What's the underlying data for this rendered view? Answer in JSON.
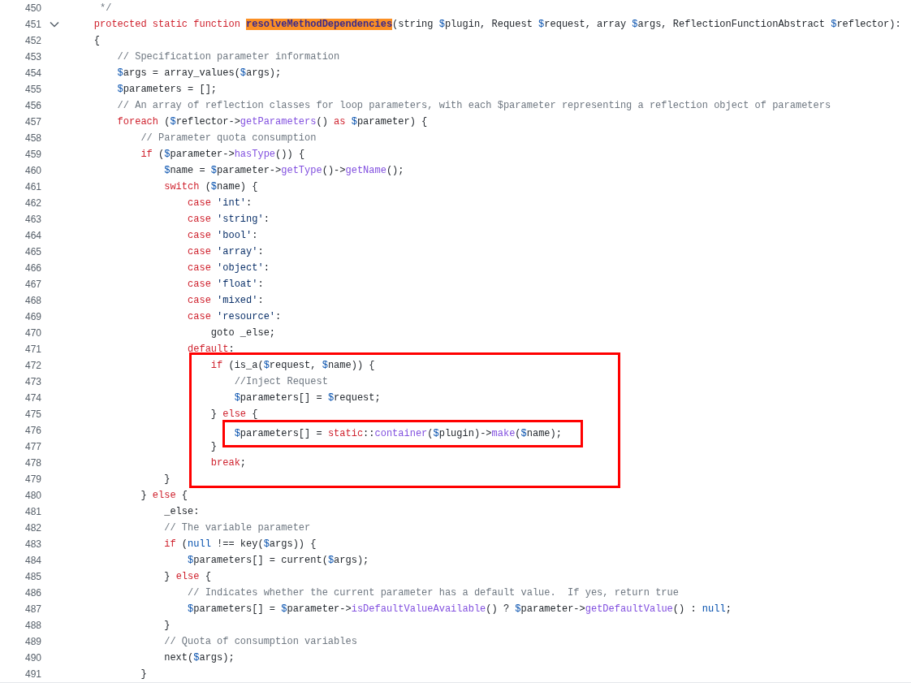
{
  "lines": [
    {
      "number": "450",
      "foldable": false,
      "tokens": [
        {
          "text": "     */",
          "kind": "comment"
        }
      ]
    },
    {
      "number": "451",
      "foldable": true,
      "tokens": [
        {
          "text": "    protected static function ",
          "kind": "keyword"
        },
        {
          "text": "resolveMethodDependencies",
          "kind": "match"
        },
        {
          "text": "(string ",
          "kind": "plain"
        },
        {
          "text": "$",
          "kind": "variable"
        },
        {
          "text": "plugin, Request ",
          "kind": "plain"
        },
        {
          "text": "$",
          "kind": "variable"
        },
        {
          "text": "request, array ",
          "kind": "plain"
        },
        {
          "text": "$",
          "kind": "variable"
        },
        {
          "text": "args, ReflectionFunctionAbstract ",
          "kind": "plain"
        },
        {
          "text": "$",
          "kind": "variable"
        },
        {
          "text": "reflector):",
          "kind": "plain"
        }
      ]
    },
    {
      "number": "452",
      "foldable": false,
      "tokens": [
        {
          "text": "    {",
          "kind": "plain"
        }
      ]
    },
    {
      "number": "453",
      "foldable": false,
      "tokens": [
        {
          "text": "        // Specification parameter information",
          "kind": "comment"
        }
      ]
    },
    {
      "number": "454",
      "foldable": false,
      "tokens": [
        {
          "text": "        $",
          "kind": "variable"
        },
        {
          "text": "args = array_values(",
          "kind": "plain"
        },
        {
          "text": "$",
          "kind": "variable"
        },
        {
          "text": "args);",
          "kind": "plain"
        }
      ]
    },
    {
      "number": "455",
      "foldable": false,
      "tokens": [
        {
          "text": "        $",
          "kind": "variable"
        },
        {
          "text": "parameters = [];",
          "kind": "plain"
        }
      ]
    },
    {
      "number": "456",
      "foldable": false,
      "tokens": [
        {
          "text": "        // An array of reflection classes for loop parameters, with each $parameter representing a reflection object of parameters",
          "kind": "comment"
        }
      ]
    },
    {
      "number": "457",
      "foldable": false,
      "tokens": [
        {
          "text": "        foreach",
          "kind": "keyword"
        },
        {
          "text": " (",
          "kind": "plain"
        },
        {
          "text": "$",
          "kind": "variable"
        },
        {
          "text": "reflector->",
          "kind": "plain"
        },
        {
          "text": "getParameters",
          "kind": "function"
        },
        {
          "text": "() ",
          "kind": "plain"
        },
        {
          "text": "as ",
          "kind": "keyword"
        },
        {
          "text": "$",
          "kind": "variable"
        },
        {
          "text": "parameter) {",
          "kind": "plain"
        }
      ]
    },
    {
      "number": "458",
      "foldable": false,
      "tokens": [
        {
          "text": "            // Parameter quota consumption",
          "kind": "comment"
        }
      ]
    },
    {
      "number": "459",
      "foldable": false,
      "tokens": [
        {
          "text": "            if",
          "kind": "keyword"
        },
        {
          "text": " (",
          "kind": "plain"
        },
        {
          "text": "$",
          "kind": "variable"
        },
        {
          "text": "parameter->",
          "kind": "plain"
        },
        {
          "text": "hasType",
          "kind": "function"
        },
        {
          "text": "()) {",
          "kind": "plain"
        }
      ]
    },
    {
      "number": "460",
      "foldable": false,
      "tokens": [
        {
          "text": "                $",
          "kind": "variable"
        },
        {
          "text": "name = ",
          "kind": "plain"
        },
        {
          "text": "$",
          "kind": "variable"
        },
        {
          "text": "parameter->",
          "kind": "plain"
        },
        {
          "text": "getType",
          "kind": "function"
        },
        {
          "text": "()->",
          "kind": "plain"
        },
        {
          "text": "getName",
          "kind": "function"
        },
        {
          "text": "();",
          "kind": "plain"
        }
      ]
    },
    {
      "number": "461",
      "foldable": false,
      "tokens": [
        {
          "text": "                switch",
          "kind": "keyword"
        },
        {
          "text": " (",
          "kind": "plain"
        },
        {
          "text": "$",
          "kind": "variable"
        },
        {
          "text": "name) {",
          "kind": "plain"
        }
      ]
    },
    {
      "number": "462",
      "foldable": false,
      "tokens": [
        {
          "text": "                    case ",
          "kind": "keyword"
        },
        {
          "text": "'int'",
          "kind": "string"
        },
        {
          "text": ":",
          "kind": "plain"
        }
      ]
    },
    {
      "number": "463",
      "foldable": false,
      "tokens": [
        {
          "text": "                    case ",
          "kind": "keyword"
        },
        {
          "text": "'string'",
          "kind": "string"
        },
        {
          "text": ":",
          "kind": "plain"
        }
      ]
    },
    {
      "number": "464",
      "foldable": false,
      "tokens": [
        {
          "text": "                    case ",
          "kind": "keyword"
        },
        {
          "text": "'bool'",
          "kind": "string"
        },
        {
          "text": ":",
          "kind": "plain"
        }
      ]
    },
    {
      "number": "465",
      "foldable": false,
      "tokens": [
        {
          "text": "                    case ",
          "kind": "keyword"
        },
        {
          "text": "'array'",
          "kind": "string"
        },
        {
          "text": ":",
          "kind": "plain"
        }
      ]
    },
    {
      "number": "466",
      "foldable": false,
      "tokens": [
        {
          "text": "                    case ",
          "kind": "keyword"
        },
        {
          "text": "'object'",
          "kind": "string"
        },
        {
          "text": ":",
          "kind": "plain"
        }
      ]
    },
    {
      "number": "467",
      "foldable": false,
      "tokens": [
        {
          "text": "                    case ",
          "kind": "keyword"
        },
        {
          "text": "'float'",
          "kind": "string"
        },
        {
          "text": ":",
          "kind": "plain"
        }
      ]
    },
    {
      "number": "468",
      "foldable": false,
      "tokens": [
        {
          "text": "                    case ",
          "kind": "keyword"
        },
        {
          "text": "'mixed'",
          "kind": "string"
        },
        {
          "text": ":",
          "kind": "plain"
        }
      ]
    },
    {
      "number": "469",
      "foldable": false,
      "tokens": [
        {
          "text": "                    case ",
          "kind": "keyword"
        },
        {
          "text": "'resource'",
          "kind": "string"
        },
        {
          "text": ":",
          "kind": "plain"
        }
      ]
    },
    {
      "number": "470",
      "foldable": false,
      "tokens": [
        {
          "text": "                        goto _else;",
          "kind": "plain"
        }
      ]
    },
    {
      "number": "471",
      "foldable": false,
      "tokens": [
        {
          "text": "                    default",
          "kind": "keyword"
        },
        {
          "text": ":",
          "kind": "plain"
        }
      ]
    },
    {
      "number": "472",
      "foldable": false,
      "tokens": [
        {
          "text": "                        if",
          "kind": "keyword"
        },
        {
          "text": " (is_a(",
          "kind": "plain"
        },
        {
          "text": "$",
          "kind": "variable"
        },
        {
          "text": "request, ",
          "kind": "plain"
        },
        {
          "text": "$",
          "kind": "variable"
        },
        {
          "text": "name)) {",
          "kind": "plain"
        }
      ]
    },
    {
      "number": "473",
      "foldable": false,
      "tokens": [
        {
          "text": "                            //Inject Request",
          "kind": "comment"
        }
      ]
    },
    {
      "number": "474",
      "foldable": false,
      "tokens": [
        {
          "text": "                            $",
          "kind": "variable"
        },
        {
          "text": "parameters[] = ",
          "kind": "plain"
        },
        {
          "text": "$",
          "kind": "variable"
        },
        {
          "text": "request;",
          "kind": "plain"
        }
      ]
    },
    {
      "number": "475",
      "foldable": false,
      "tokens": [
        {
          "text": "                        } ",
          "kind": "plain"
        },
        {
          "text": "else",
          "kind": "keyword"
        },
        {
          "text": " {",
          "kind": "plain"
        }
      ]
    },
    {
      "number": "476",
      "foldable": false,
      "framed": true,
      "tokens": [
        {
          "text": "                            $",
          "kind": "variable"
        },
        {
          "text": "parameters[] = ",
          "kind": "plain"
        },
        {
          "text": "static",
          "kind": "keyword"
        },
        {
          "text": "::",
          "kind": "plain"
        },
        {
          "text": "container",
          "kind": "function"
        },
        {
          "text": "(",
          "kind": "plain"
        },
        {
          "text": "$",
          "kind": "variable"
        },
        {
          "text": "plugin)->",
          "kind": "plain"
        },
        {
          "text": "make",
          "kind": "function"
        },
        {
          "text": "(",
          "kind": "plain"
        },
        {
          "text": "$",
          "kind": "variable"
        },
        {
          "text": "name);",
          "kind": "plain"
        }
      ]
    },
    {
      "number": "477",
      "foldable": false,
      "tokens": [
        {
          "text": "                        }",
          "kind": "plain"
        }
      ]
    },
    {
      "number": "478",
      "foldable": false,
      "tokens": [
        {
          "text": "                        break",
          "kind": "keyword"
        },
        {
          "text": ";",
          "kind": "plain"
        }
      ]
    },
    {
      "number": "479",
      "foldable": false,
      "tokens": [
        {
          "text": "                }",
          "kind": "plain"
        }
      ]
    },
    {
      "number": "480",
      "foldable": false,
      "tokens": [
        {
          "text": "            } ",
          "kind": "plain"
        },
        {
          "text": "else",
          "kind": "keyword"
        },
        {
          "text": " {",
          "kind": "plain"
        }
      ]
    },
    {
      "number": "481",
      "foldable": false,
      "tokens": [
        {
          "text": "                _else:",
          "kind": "plain"
        }
      ]
    },
    {
      "number": "482",
      "foldable": false,
      "tokens": [
        {
          "text": "                // The variable parameter",
          "kind": "comment"
        }
      ]
    },
    {
      "number": "483",
      "foldable": false,
      "tokens": [
        {
          "text": "                if",
          "kind": "keyword"
        },
        {
          "text": " (",
          "kind": "plain"
        },
        {
          "text": "null",
          "kind": "constant"
        },
        {
          "text": " !== key(",
          "kind": "plain"
        },
        {
          "text": "$",
          "kind": "variable"
        },
        {
          "text": "args)) {",
          "kind": "plain"
        }
      ]
    },
    {
      "number": "484",
      "foldable": false,
      "tokens": [
        {
          "text": "                    $",
          "kind": "variable"
        },
        {
          "text": "parameters[] = current(",
          "kind": "plain"
        },
        {
          "text": "$",
          "kind": "variable"
        },
        {
          "text": "args);",
          "kind": "plain"
        }
      ]
    },
    {
      "number": "485",
      "foldable": false,
      "tokens": [
        {
          "text": "                } ",
          "kind": "plain"
        },
        {
          "text": "else",
          "kind": "keyword"
        },
        {
          "text": " {",
          "kind": "plain"
        }
      ]
    },
    {
      "number": "486",
      "foldable": false,
      "tokens": [
        {
          "text": "                    // Indicates whether the current parameter has a default value.  If yes, return true",
          "kind": "comment"
        }
      ]
    },
    {
      "number": "487",
      "foldable": false,
      "tokens": [
        {
          "text": "                    $",
          "kind": "variable"
        },
        {
          "text": "parameters[] = ",
          "kind": "plain"
        },
        {
          "text": "$",
          "kind": "variable"
        },
        {
          "text": "parameter->",
          "kind": "plain"
        },
        {
          "text": "isDefaultValueAvailable",
          "kind": "function"
        },
        {
          "text": "() ? ",
          "kind": "plain"
        },
        {
          "text": "$",
          "kind": "variable"
        },
        {
          "text": "parameter->",
          "kind": "plain"
        },
        {
          "text": "getDefaultValue",
          "kind": "function"
        },
        {
          "text": "() : ",
          "kind": "plain"
        },
        {
          "text": "null",
          "kind": "constant"
        },
        {
          "text": ";",
          "kind": "plain"
        }
      ]
    },
    {
      "number": "488",
      "foldable": false,
      "tokens": [
        {
          "text": "                }",
          "kind": "plain"
        }
      ]
    },
    {
      "number": "489",
      "foldable": false,
      "tokens": [
        {
          "text": "                // Quota of consumption variables",
          "kind": "comment"
        }
      ]
    },
    {
      "number": "490",
      "foldable": false,
      "tokens": [
        {
          "text": "                next(",
          "kind": "plain"
        },
        {
          "text": "$",
          "kind": "variable"
        },
        {
          "text": "args);",
          "kind": "plain"
        }
      ]
    },
    {
      "number": "491",
      "foldable": false,
      "tokens": [
        {
          "text": "            }",
          "kind": "plain"
        }
      ]
    }
  ]
}
